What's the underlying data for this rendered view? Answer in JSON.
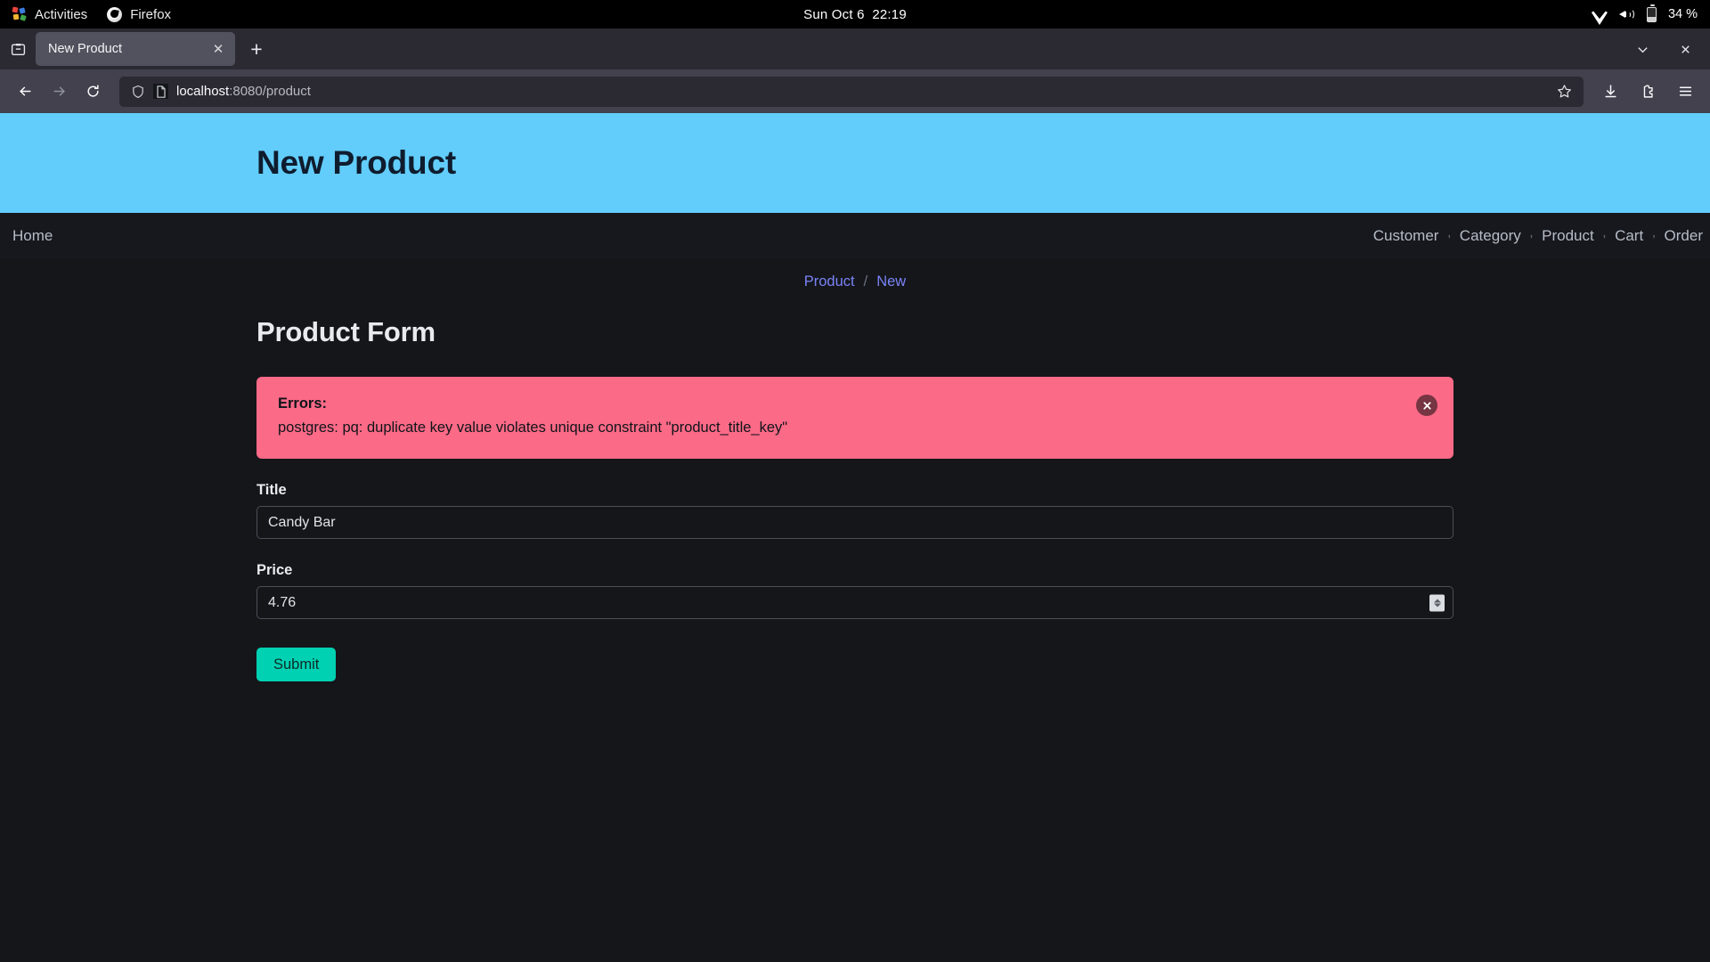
{
  "os_bar": {
    "activities": "Activities",
    "app_name": "Firefox",
    "clock": "Sun Oct 6  22:19",
    "battery": "34 %",
    "icons": [
      "activities-icon",
      "firefox-icon",
      "wifi-icon",
      "volume-icon",
      "battery-icon"
    ]
  },
  "browser": {
    "tab_title": "New Product",
    "tab_close_glyph": "✕",
    "new_tab_glyph": "+",
    "url_display": "localhost:8080/product",
    "url_host": "localhost",
    "url_path": ":8080/product",
    "icons": [
      "tab-list-icon",
      "back-icon",
      "forward-icon",
      "reload-icon",
      "shield-icon",
      "page-icon",
      "bookmark-star-icon",
      "downloads-icon",
      "extensions-icon",
      "app-menu-icon",
      "window-minimize-icon",
      "window-close-icon"
    ]
  },
  "hero": {
    "title": "New Product",
    "bg_color": "#62cdfb",
    "text_color": "#0f1c2e"
  },
  "site_nav": {
    "home_label": "Home",
    "separator": "’",
    "links": [
      "Customer",
      "Category",
      "Product",
      "Cart",
      "Order"
    ]
  },
  "breadcrumb": {
    "items": [
      "Product",
      "New"
    ],
    "separator": "/",
    "link_color": "#7a83f5"
  },
  "form": {
    "heading": "Product Form",
    "fields": [
      {
        "label": "Title",
        "value": "Candy Bar",
        "type": "text"
      },
      {
        "label": "Price",
        "value": "4.76",
        "type": "number"
      }
    ],
    "submit_label": "Submit",
    "submit_color": "#00d1b2"
  },
  "alert": {
    "title": "Errors:",
    "message": "postgres: pq: duplicate key value violates unique constraint \"product_title_key\"",
    "bg_color": "#fb6a87",
    "close_glyph": "✕"
  }
}
